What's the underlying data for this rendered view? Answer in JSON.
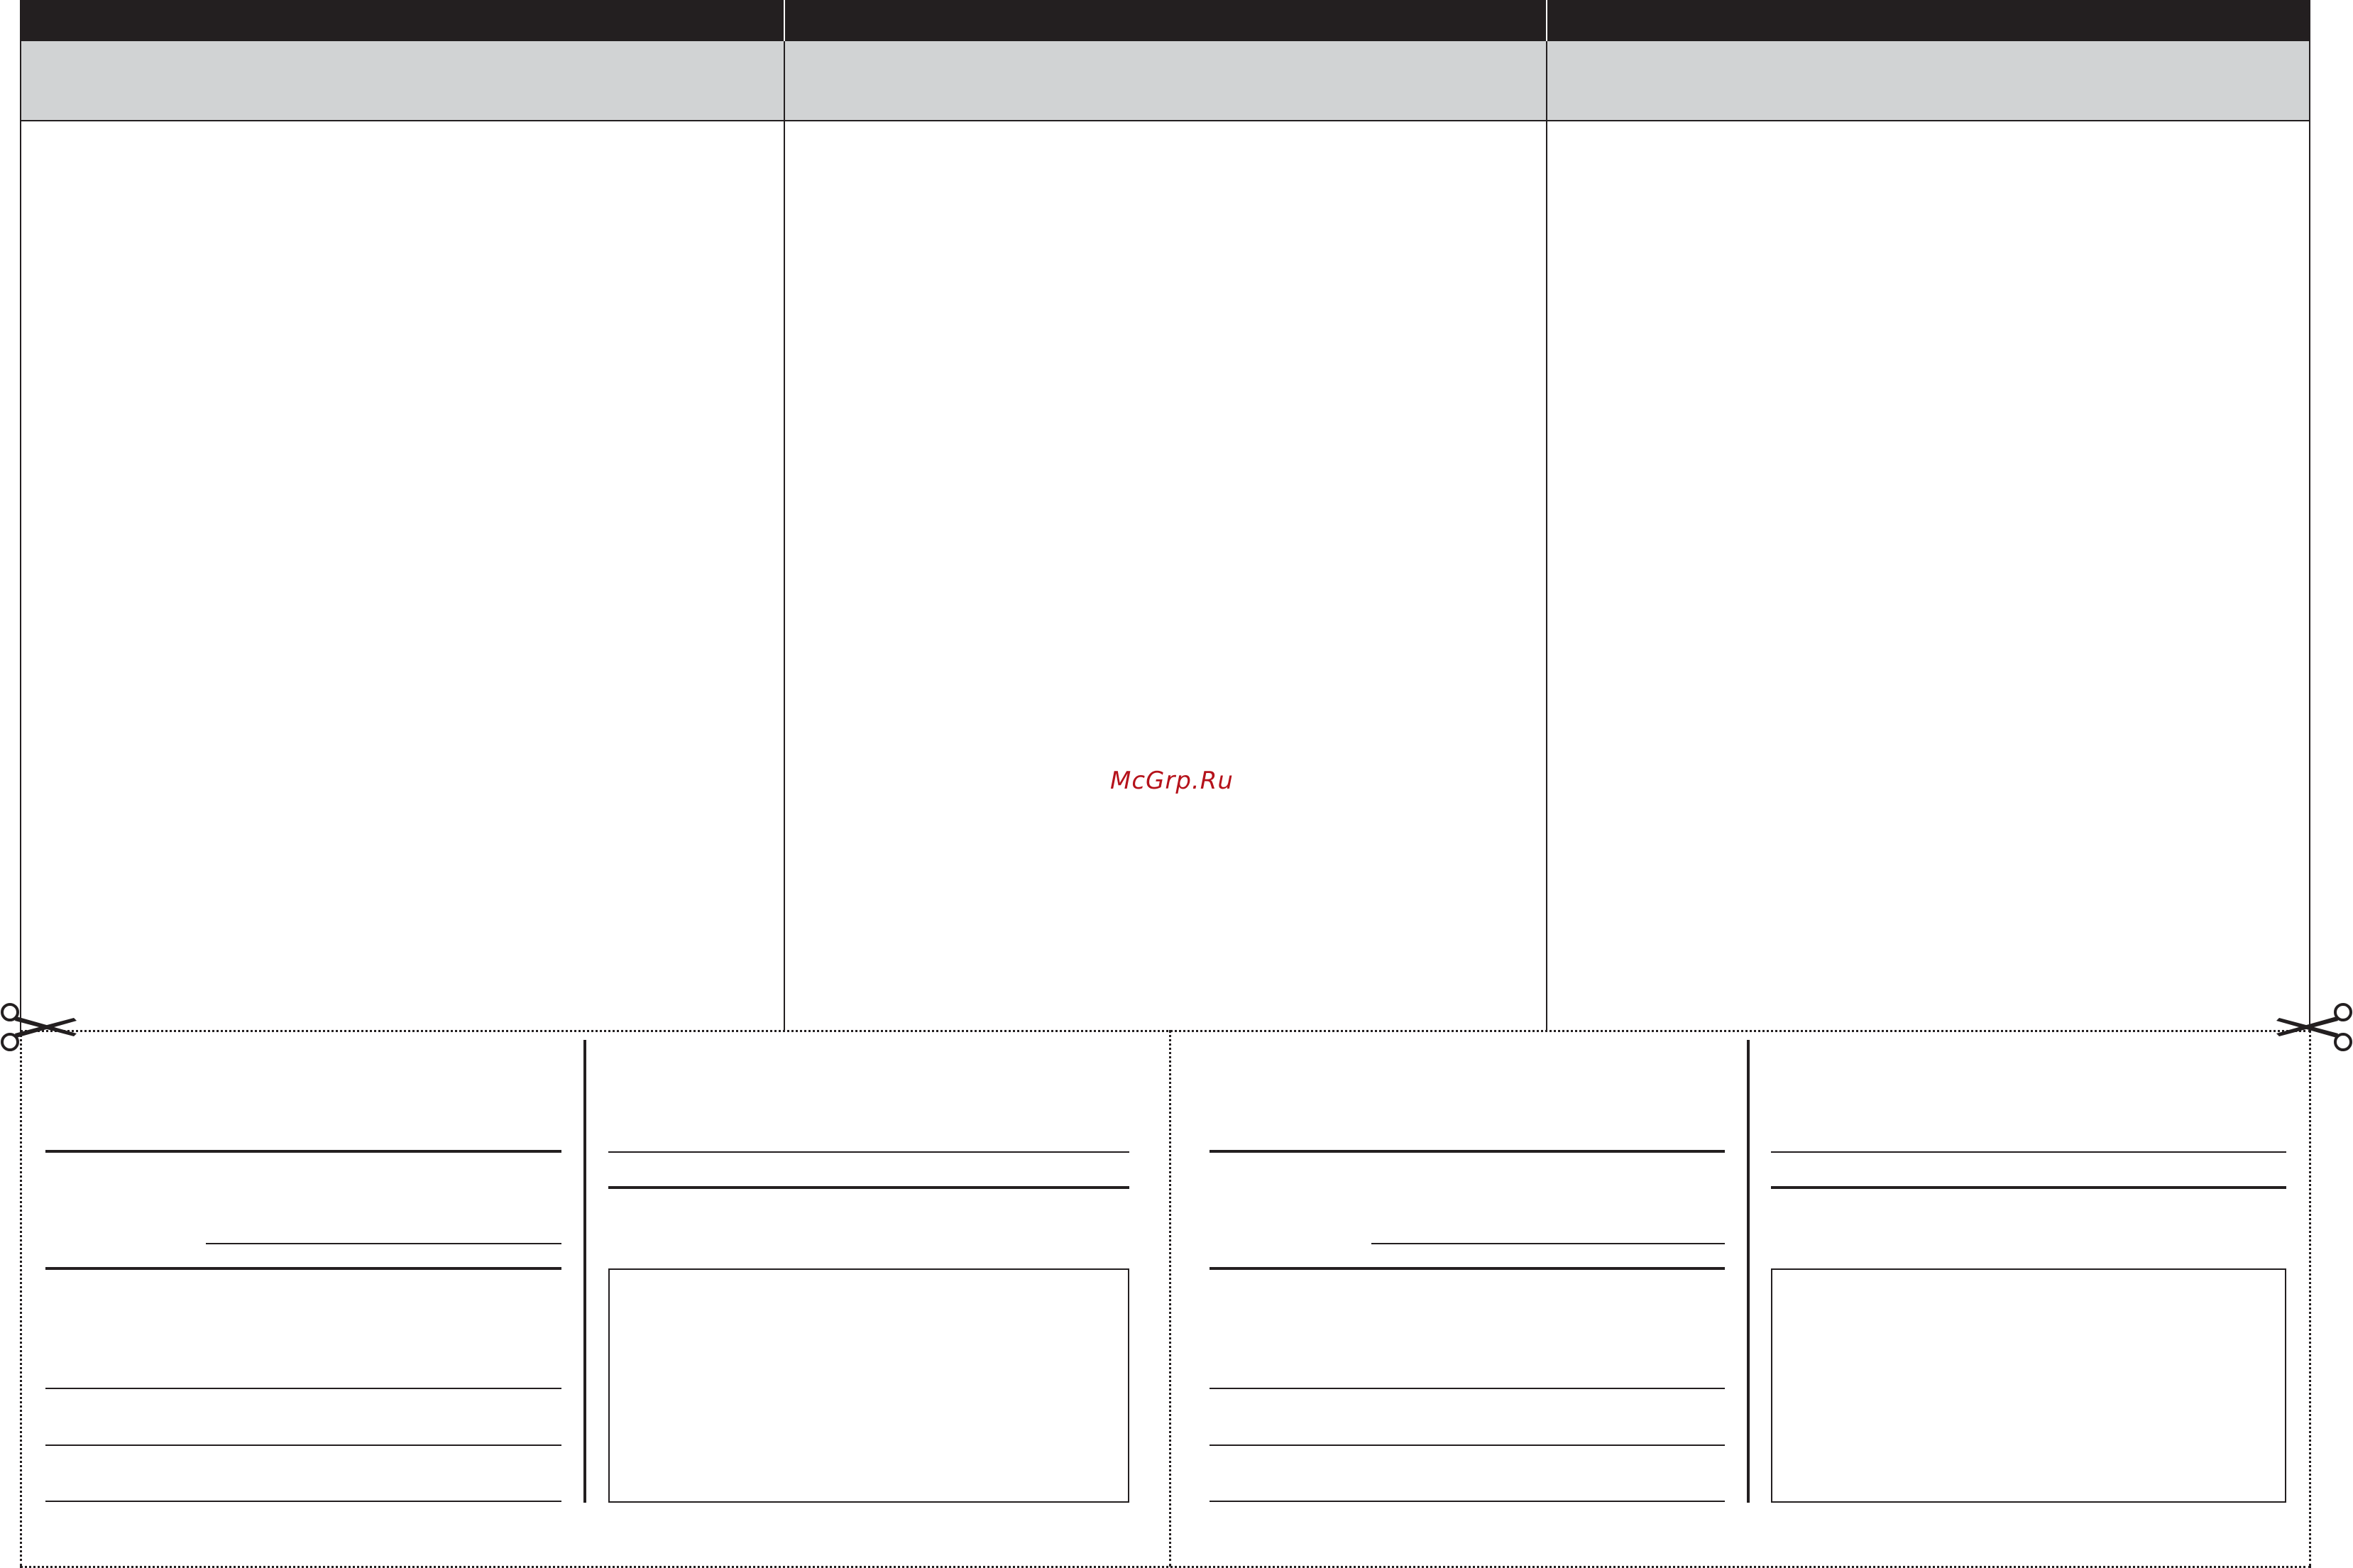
{
  "watermark": {
    "text": "McGrp.Ru",
    "color": "#b5121b"
  },
  "colors": {
    "header": "#231f20",
    "subheader": "#d1d3d4",
    "lines": "#231f20"
  },
  "icons": {
    "left_cut": "scissors-icon",
    "right_cut": "scissors-icon"
  }
}
